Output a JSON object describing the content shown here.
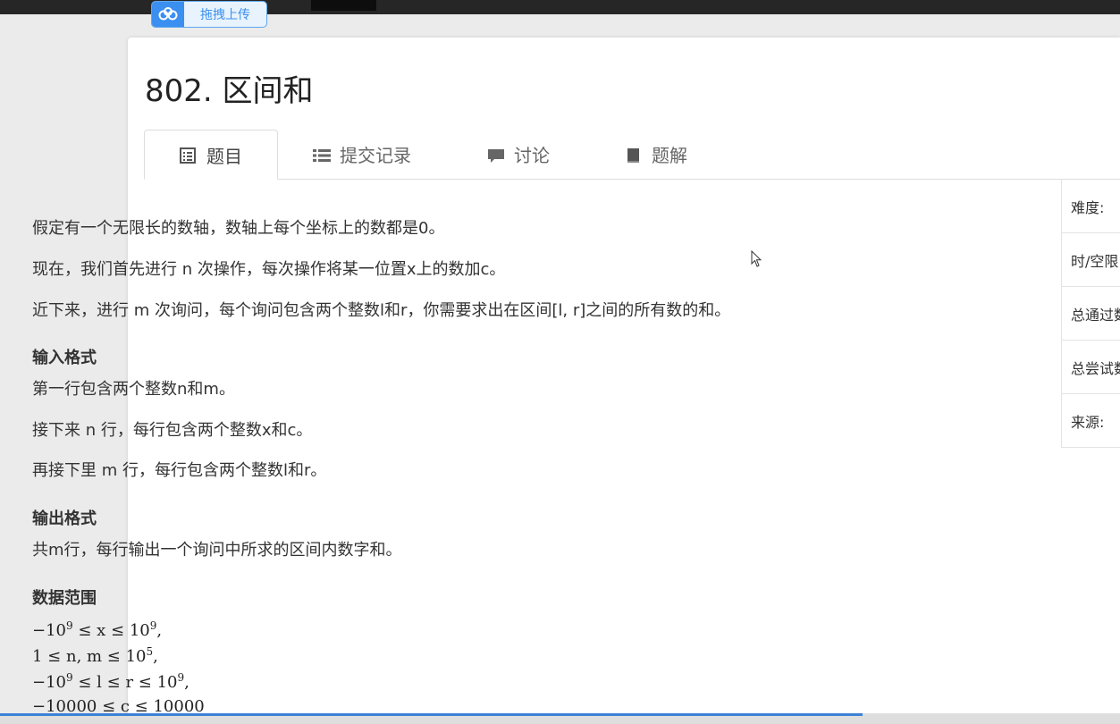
{
  "toolbar": {
    "upload_label": "拖拽上传"
  },
  "problem": {
    "title": "802. 区间和"
  },
  "tabs": [
    {
      "label": "题目",
      "icon": "list-alt-icon",
      "active": true
    },
    {
      "label": "提交记录",
      "icon": "list-icon"
    },
    {
      "label": "讨论",
      "icon": "comment-icon"
    },
    {
      "label": "题解",
      "icon": "book-icon"
    }
  ],
  "description": {
    "p1": "假定有一个无限长的数轴，数轴上每个坐标上的数都是0。",
    "p2": "现在，我们首先进行 n 次操作，每次操作将某一位置x上的数加c。",
    "p3": "近下来，进行 m 次询问，每个询问包含两个整数l和r，你需要求出在区间[l, r]之间的所有数的和。"
  },
  "input_format": {
    "heading": "输入格式",
    "l1": "第一行包含两个整数n和m。",
    "l2": "接下来 n 行，每行包含两个整数x和c。",
    "l3": "再接下里 m 行，每行包含两个整数l和r。"
  },
  "output_format": {
    "heading": "输出格式",
    "l1": "共m行，每行输出一个询问中所求的区间内数字和。"
  },
  "range": {
    "heading": "数据范围",
    "c1": {
      "pre": "−10",
      "sup1": "9",
      "mid": " ≤ x ≤ 10",
      "sup2": "9",
      "post": ","
    },
    "c2": {
      "pre": "1 ≤ n, m ≤ 10",
      "sup1": "5",
      "post": ","
    },
    "c3": {
      "pre": "−10",
      "sup1": "9",
      "mid": " ≤ l ≤ r ≤ 10",
      "sup2": "9",
      "post": ","
    },
    "c4": {
      "text": "−10000 ≤ c ≤ 10000"
    }
  },
  "sidebar": [
    {
      "label": "难度:"
    },
    {
      "label": "时/空限"
    },
    {
      "label": "总通过数"
    },
    {
      "label": "总尝试数"
    },
    {
      "label": "来源:"
    }
  ],
  "colors": {
    "accent": "#3a8ff0",
    "scroll_thumb": "#3b82d6"
  }
}
